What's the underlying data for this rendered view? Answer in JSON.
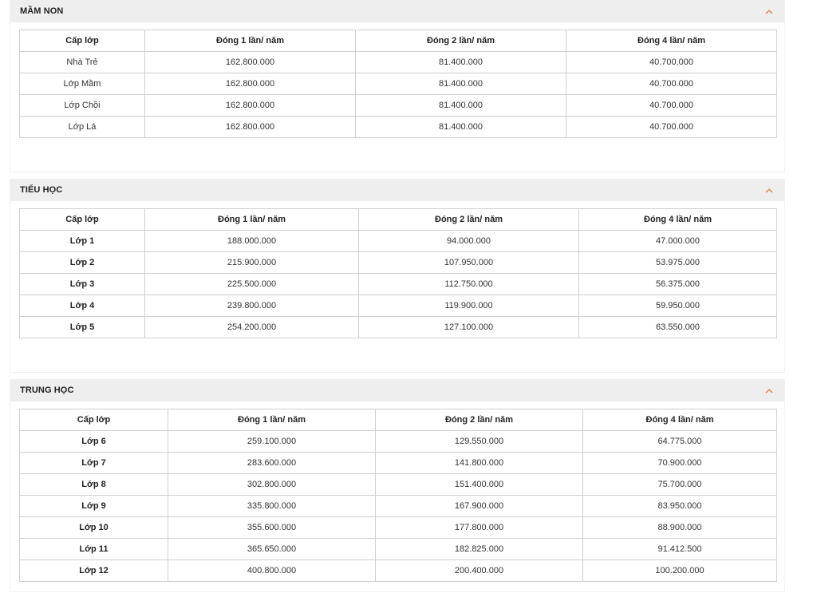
{
  "accent_color": "#e07a52",
  "sections": [
    {
      "title": "MẦM NON",
      "headers": [
        "Cấp lớp",
        "Đóng 1 lần/ năm",
        "Đóng 2 lần/ năm",
        "Đóng 4 lần/ năm"
      ],
      "rows": [
        [
          "Nhà Trẻ",
          "162.800.000",
          "81.400.000",
          "40.700.000"
        ],
        [
          "Lớp Mầm",
          "162.800.000",
          "81.400.000",
          "40.700.000"
        ],
        [
          "Lớp Chồi",
          "162.800.000",
          "81.400.000",
          "40.700.000"
        ],
        [
          "Lớp Lá",
          "162.800.000",
          "81.400.000",
          "40.700.000"
        ]
      ]
    },
    {
      "title": "TIỂU HỌC",
      "headers": [
        "Cấp lớp",
        "Đóng 1 lần/ năm",
        "Đóng 2 lần/ năm",
        "Đóng 4 lần/ năm"
      ],
      "rows": [
        [
          "Lớp 1",
          "188.000.000",
          "94.000.000",
          "47.000.000"
        ],
        [
          "Lớp 2",
          "215.900.000",
          "107.950.000",
          "53.975.000"
        ],
        [
          "Lớp 3",
          "225.500.000",
          "112.750.000",
          "56.375.000"
        ],
        [
          "Lớp 4",
          "239.800.000",
          "119.900.000",
          "59.950.000"
        ],
        [
          "Lớp 5",
          "254.200.000",
          "127.100.000",
          "63.550.000"
        ]
      ]
    },
    {
      "title": "TRUNG HỌC",
      "headers": [
        "Cấp lớp",
        "Đóng 1 lần/ năm",
        "Đóng 2 lần/ năm",
        "Đóng 4 lần/ năm"
      ],
      "rows": [
        [
          "Lớp 6",
          "259.100.000",
          "129.550.000",
          "64.775.000"
        ],
        [
          "Lớp 7",
          "283.600.000",
          "141.800.000",
          "70.900.000"
        ],
        [
          "Lớp 8",
          "302.800.000",
          "151.400.000",
          "75.700.000"
        ],
        [
          "Lớp 9",
          "335.800.000",
          "167.900.000",
          "83.950.000"
        ],
        [
          "Lớp 10",
          "355.600.000",
          "177.800.000",
          "88.900.000"
        ],
        [
          "Lớp 11",
          "365.650.000",
          "182.825.000",
          "91.412.500"
        ],
        [
          "Lớp 12",
          "400.800.000",
          "200.400.000",
          "100.200.000"
        ]
      ]
    }
  ]
}
